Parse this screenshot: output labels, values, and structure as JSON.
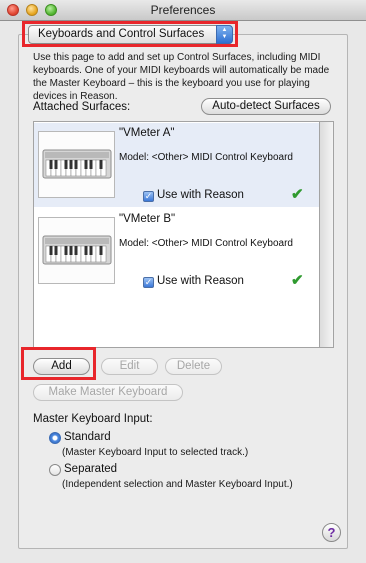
{
  "window": {
    "title": "Preferences"
  },
  "page_selector": {
    "value": "Keyboards and Control Surfaces"
  },
  "description": "Use this page to add and set up Control Surfaces, including MIDI keyboards. One of your MIDI keyboards will automatically be made the Master Keyboard – this is the keyboard you use for playing devices in Reason.",
  "attached_label": "Attached Surfaces:",
  "autodetect_label": "Auto-detect Surfaces",
  "surfaces": [
    {
      "name": "\"VMeter A\"",
      "model": "Model: <Other> MIDI Control Keyboard",
      "use_label": "Use with Reason",
      "use_checked": true
    },
    {
      "name": "\"VMeter B\"",
      "model": "Model: <Other> MIDI Control Keyboard",
      "use_label": "Use with Reason",
      "use_checked": true
    }
  ],
  "buttons": {
    "add": "Add",
    "edit": "Edit",
    "delete": "Delete",
    "make_master": "Make Master Keyboard"
  },
  "master_input": {
    "label": "Master Keyboard Input:",
    "selected": "Standard",
    "options": [
      {
        "label": "Standard",
        "desc": "(Master Keyboard Input to selected track.)"
      },
      {
        "label": "Separated",
        "desc": "(Independent selection and Master Keyboard Input.)"
      }
    ]
  },
  "help_label": "?",
  "colors": {
    "highlight": "#e8262b",
    "selected_row": "#e6ecf7",
    "check_green": "#2f9a2f",
    "accent_blue": "#3b78d8"
  }
}
